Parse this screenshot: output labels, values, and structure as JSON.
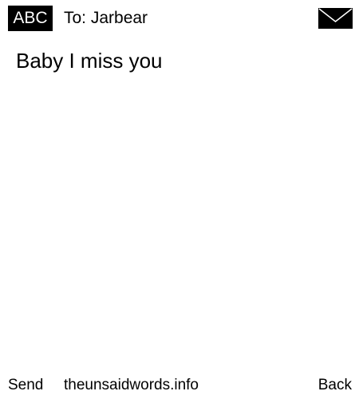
{
  "header": {
    "input_mode": "ABC",
    "recipient": "To: Jarbear",
    "envelope_icon": "envelope-icon"
  },
  "message": {
    "body": "Baby I miss you"
  },
  "softkeys": {
    "left_label": "Send",
    "center_text": "theunsaidwords.info",
    "right_label": "Back"
  },
  "colors": {
    "background": "#ffffff",
    "foreground": "#000000"
  }
}
